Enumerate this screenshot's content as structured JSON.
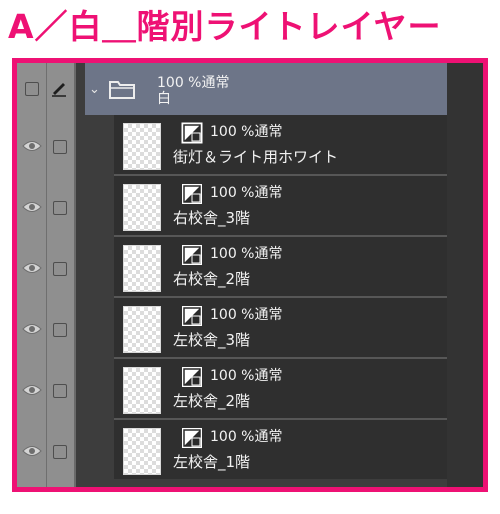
{
  "title": "A／白＿階別ライトレイヤー",
  "folder": {
    "opacity": "100 %",
    "blend_mode": "通常",
    "name": "白"
  },
  "layers": [
    {
      "opacity": "100 %",
      "blend_mode": "通常",
      "name": "街灯＆ライト用ホワイト"
    },
    {
      "opacity": "100 %",
      "blend_mode": "通常",
      "name": "右校舎_3階"
    },
    {
      "opacity": "100 %",
      "blend_mode": "通常",
      "name": "右校舎_2階"
    },
    {
      "opacity": "100 %",
      "blend_mode": "通常",
      "name": "左校舎_3階"
    },
    {
      "opacity": "100 %",
      "blend_mode": "通常",
      "name": "左校舎_2階"
    },
    {
      "opacity": "100 %",
      "blend_mode": "通常",
      "name": "左校舎_1階"
    }
  ],
  "colors": {
    "title": "#ee1174",
    "frame": "#ee1174",
    "folder_highlight": "#6d7588",
    "layer_bg": "#2f2f2f"
  },
  "icons": {
    "visibility": "eye-icon",
    "edit": "pen-icon",
    "expand": "chevron-down-icon",
    "folder": "folder-icon",
    "layer_type": "raster-layer-icon"
  }
}
